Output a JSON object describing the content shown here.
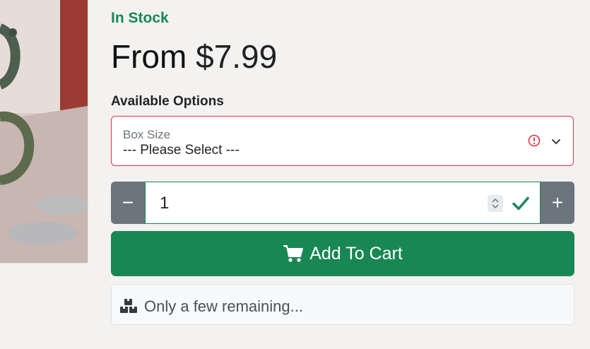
{
  "product": {
    "stock_status": "In Stock",
    "price_prefix": "From",
    "price_amount": "$7.99"
  },
  "options": {
    "heading": "Available Options",
    "box_size": {
      "label": "Box Size",
      "value": "--- Please Select ---",
      "state": "invalid"
    }
  },
  "quantity": {
    "value": "1",
    "decrement_label": "−",
    "increment_label": "+",
    "state": "valid"
  },
  "cart": {
    "button_label": "Add To Cart",
    "icon": "shopping-cart-icon"
  },
  "stock_note": {
    "text": "Only a few remaining...",
    "icon": "boxes-icon"
  },
  "colors": {
    "success": "#198754",
    "danger": "#dc3545",
    "secondary": "#6c757d"
  }
}
